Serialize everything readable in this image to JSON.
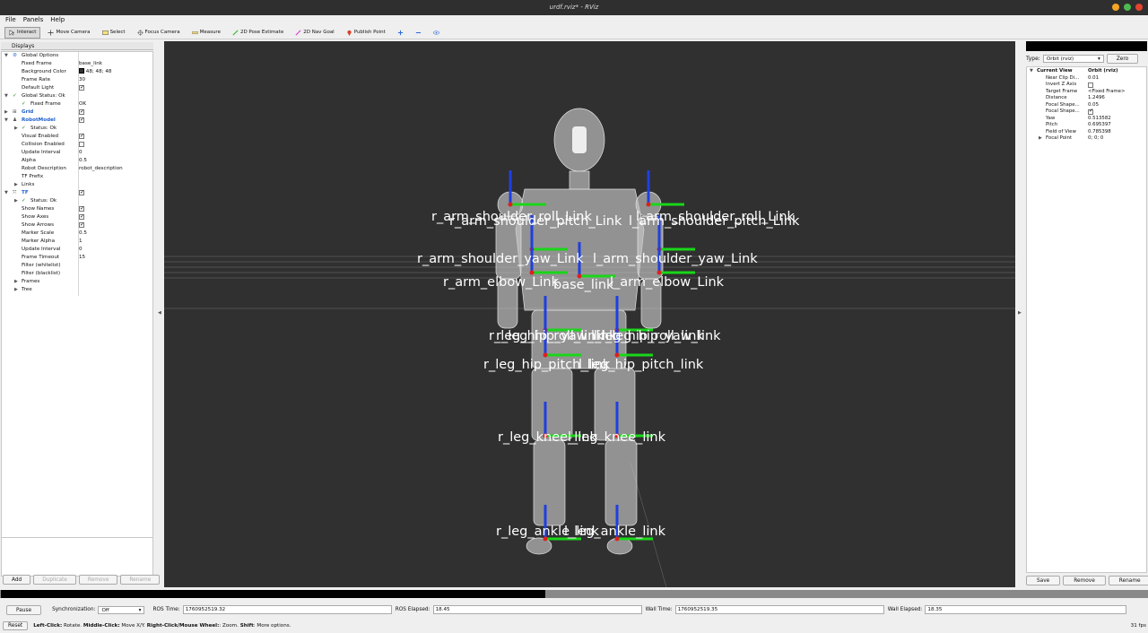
{
  "window": {
    "title": "urdf.rviz* - RViz"
  },
  "menu": [
    "File",
    "Panels",
    "Help"
  ],
  "toolbar": {
    "interact": "Interact",
    "move_camera": "Move Camera",
    "select": "Select",
    "focus_camera": "Focus Camera",
    "measure": "Measure",
    "pose_estimate": "2D Pose Estimate",
    "nav_goal": "2D Nav Goal",
    "publish_point": "Publish Point"
  },
  "displays": {
    "title": "Displays",
    "rows": [
      {
        "key": "Global Options",
        "value": ""
      },
      {
        "key": "Fixed Frame",
        "value": "base_link"
      },
      {
        "key": "Background Color",
        "value": "48; 48; 48"
      },
      {
        "key": "Frame Rate",
        "value": "30"
      },
      {
        "key": "Default Light",
        "value": ""
      },
      {
        "key": "Global Status: Ok",
        "value": ""
      },
      {
        "key": "Fixed Frame",
        "value": "OK"
      },
      {
        "key": "Grid",
        "value": ""
      },
      {
        "key": "RobotModel",
        "value": ""
      },
      {
        "key": "Status: Ok",
        "value": ""
      },
      {
        "key": "Visual Enabled",
        "value": ""
      },
      {
        "key": "Collision Enabled",
        "value": ""
      },
      {
        "key": "Update Interval",
        "value": "0"
      },
      {
        "key": "Alpha",
        "value": "0.5"
      },
      {
        "key": "Robot Description",
        "value": "robot_description"
      },
      {
        "key": "TF Prefix",
        "value": ""
      },
      {
        "key": "Links",
        "value": ""
      },
      {
        "key": "TF",
        "value": ""
      },
      {
        "key": "Status: Ok",
        "value": ""
      },
      {
        "key": "Show Names",
        "value": ""
      },
      {
        "key": "Show Axes",
        "value": ""
      },
      {
        "key": "Show Arrows",
        "value": ""
      },
      {
        "key": "Marker Scale",
        "value": "0.5"
      },
      {
        "key": "Marker Alpha",
        "value": "1"
      },
      {
        "key": "Update Interval",
        "value": "0"
      },
      {
        "key": "Frame Timeout",
        "value": "15"
      },
      {
        "key": "Filter (whitelist)",
        "value": ""
      },
      {
        "key": "Filter (blacklist)",
        "value": ""
      },
      {
        "key": "Frames",
        "value": ""
      },
      {
        "key": "Tree",
        "value": ""
      }
    ],
    "buttons": [
      "Add",
      "Duplicate",
      "Remove",
      "Rename"
    ]
  },
  "viewport": {
    "labels": [
      "r_arm_shoulder_roll_Link",
      "l_arm_shoulder_roll_Link",
      "r_arm_shoulder_pitch_Link",
      "l_arm_shoulder_pitch_Link",
      "r_arm_shoulder_yaw_Link",
      "l_arm_shoulder_yaw_Link",
      "r_arm_elbow_Link",
      "l_arm_elbow_Link",
      "base_link",
      "r_leg_hip_roll_link",
      "l_leg_hip_roll_link",
      "r_leg_hip_yaw_link",
      "l_leg_hip_yaw_link",
      "r_leg_hip_pitch_link",
      "l_leg_hip_pitch_link",
      "r_leg_knee_link",
      "l_leg_knee_link",
      "r_leg_ankle_link",
      "l_leg_ankle_link"
    ]
  },
  "views": {
    "type_label": "Type:",
    "type_value": "Orbit (rviz)",
    "zero": "Zero",
    "rows": [
      {
        "key": "Current View",
        "value": "Orbit (rviz)"
      },
      {
        "key": "Near Clip Di...",
        "value": "0.01"
      },
      {
        "key": "Invert Z Axis",
        "value": ""
      },
      {
        "key": "Target Frame",
        "value": "<Fixed Frame>"
      },
      {
        "key": "Distance",
        "value": "1.2496"
      },
      {
        "key": "Focal Shape...",
        "value": "0.05"
      },
      {
        "key": "Focal Shape...",
        "value": ""
      },
      {
        "key": "Yaw",
        "value": "0.513582"
      },
      {
        "key": "Pitch",
        "value": "0.695397"
      },
      {
        "key": "Field of View",
        "value": "0.785398"
      },
      {
        "key": "Focal Point",
        "value": "0; 0; 0"
      }
    ],
    "buttons": [
      "Save",
      "Remove",
      "Rename"
    ]
  },
  "time": {
    "pause": "Pause",
    "sync_label": "Synchronization:",
    "sync_value": "Off",
    "ros_time_label": "ROS Time:",
    "ros_time": "1760952519.32",
    "ros_elapsed_label": "ROS Elapsed:",
    "ros_elapsed": "18.45",
    "wall_time_label": "Wall Time:",
    "wall_time": "1760952519.35",
    "wall_elapsed_label": "Wall Elapsed:",
    "wall_elapsed": "18.35"
  },
  "status": {
    "reset": "Reset",
    "hint_left": "Left-Click:",
    "hint_left_txt": " Rotate. ",
    "hint_middle": "Middle-Click:",
    "hint_middle_txt": " Move X/Y. ",
    "hint_right": "Right-Click/Mouse Wheel:",
    "hint_right_txt": ": Zoom. ",
    "hint_shift": "Shift",
    "hint_shift_txt": ": More options.",
    "fps": "31 fps"
  },
  "progress": {
    "fraction": 0.475
  }
}
